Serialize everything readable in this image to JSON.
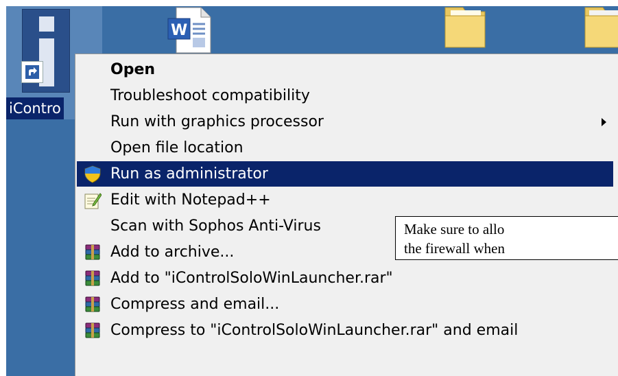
{
  "desktop": {
    "icontrol_label": "iContro"
  },
  "context_menu": {
    "items": [
      {
        "label": "Open",
        "bold": true
      },
      {
        "label": "Troubleshoot compatibility"
      },
      {
        "label": "Run with graphics processor",
        "submenu": true
      },
      {
        "label": "Open file location"
      },
      {
        "label": "Run as administrator",
        "selected": true,
        "icon": "uac-shield-icon"
      },
      {
        "label": "Edit with Notepad++",
        "icon": "notepadpp-icon"
      },
      {
        "label": "Scan with Sophos Anti-Virus"
      },
      {
        "label": "Add to archive...",
        "icon": "winrar-icon"
      },
      {
        "label": "Add to \"iControlSoloWinLauncher.rar\"",
        "icon": "winrar-icon"
      },
      {
        "label": "Compress and email...",
        "icon": "winrar-icon"
      },
      {
        "label": "Compress to \"iControlSoloWinLauncher.rar\" and email",
        "icon": "winrar-icon"
      }
    ]
  },
  "callout": {
    "line1": "Make sure to allo",
    "line2": "the firewall when"
  },
  "colors": {
    "desktop_bg": "#3a6ea5",
    "menu_bg": "#f0f0f0",
    "selection": "#0a246a"
  }
}
